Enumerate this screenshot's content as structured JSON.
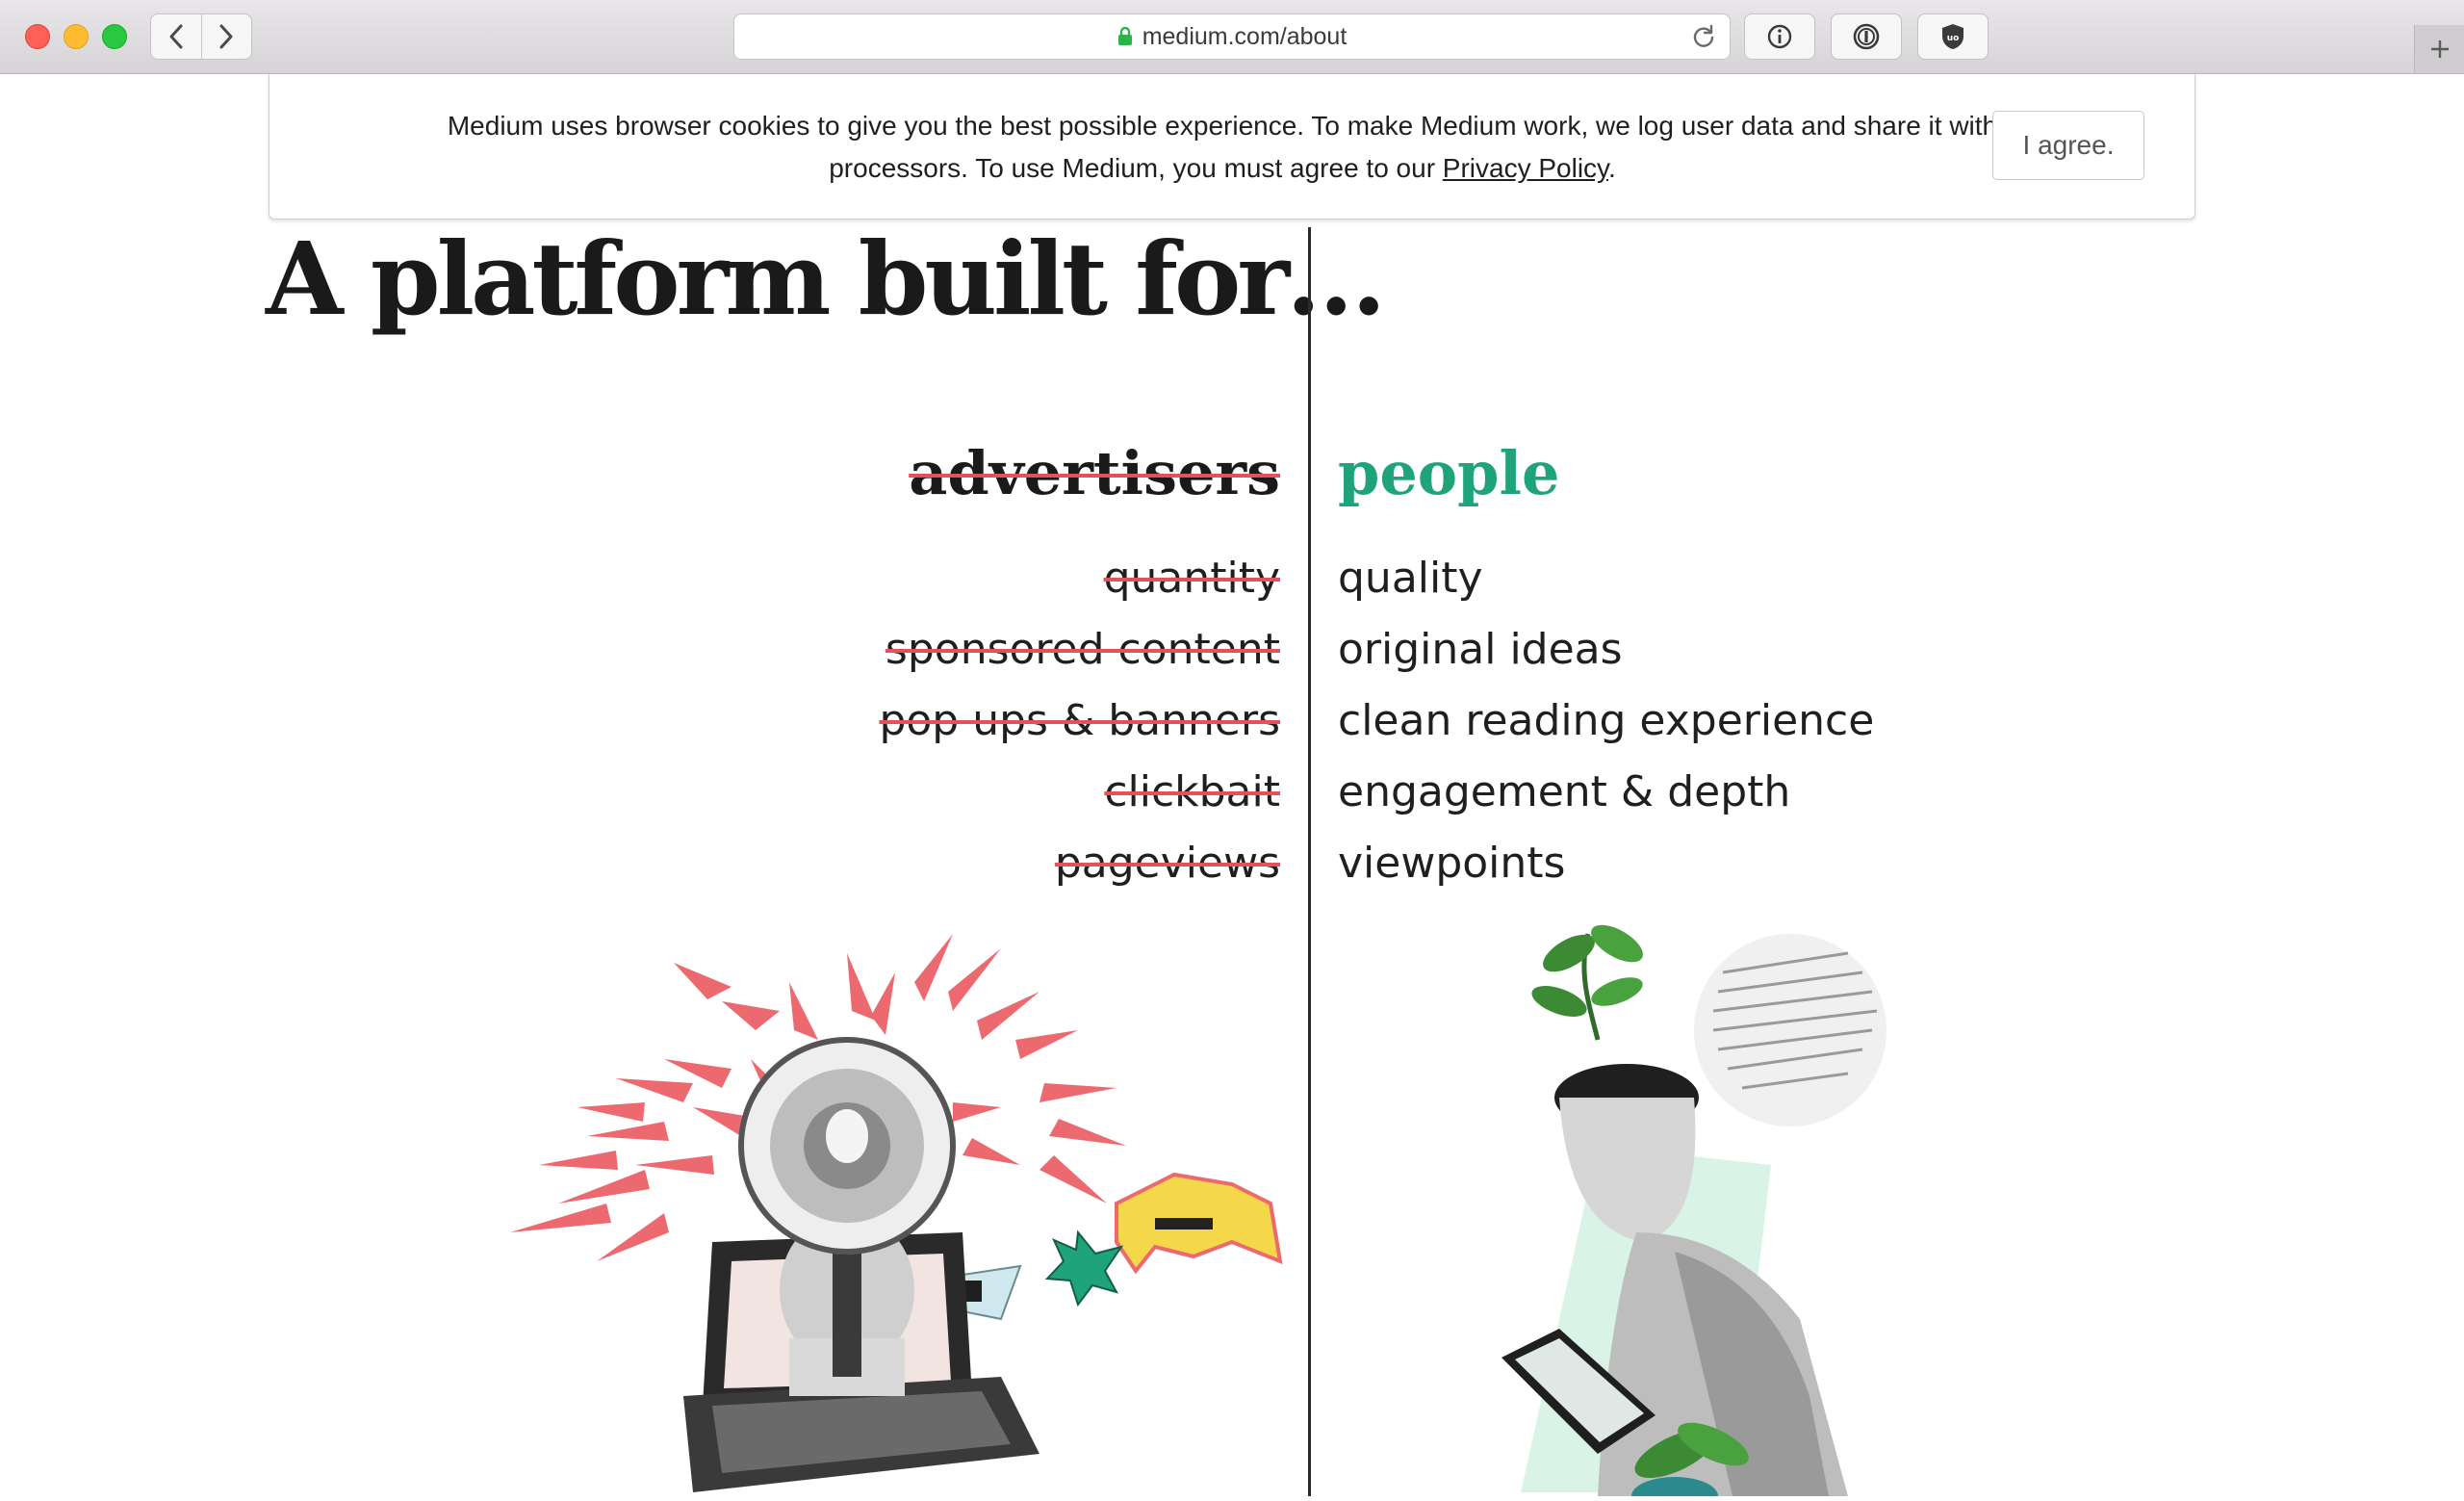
{
  "browser": {
    "url": "medium.com/about",
    "back_icon": "chevron-left-icon",
    "forward_icon": "chevron-right-icon",
    "lock_icon": "lock-icon",
    "reload_icon": "reload-icon",
    "toolbar_icons": [
      "info-icon",
      "password-manager-icon",
      "ublock-shield-icon"
    ],
    "new_tab_icon": "plus-icon"
  },
  "cookie_banner": {
    "line1": "Medium uses browser cookies to give you the best possible experience. To make Medium work, we log user data and share it with",
    "line2_prefix": "processors. To use Medium, you must agree to our ",
    "link": "Privacy Policy",
    "line2_suffix": ".",
    "button": "I agree."
  },
  "hero": {
    "title": "A platform built for…"
  },
  "comparison": {
    "left_heading": "advertisers",
    "right_heading": "people",
    "left_items": [
      "quantity",
      "sponsored content",
      "pop ups & banners",
      "clickbait",
      "pageviews"
    ],
    "right_items": [
      "quality",
      "original ideas",
      "clean reading experience",
      "engagement & depth",
      "viewpoints"
    ]
  },
  "colors": {
    "accent_green": "#1ea37a",
    "strike_red": "#e4515a",
    "arrow_red": "#ec6a6f",
    "text_dark": "#1a1a1a"
  }
}
